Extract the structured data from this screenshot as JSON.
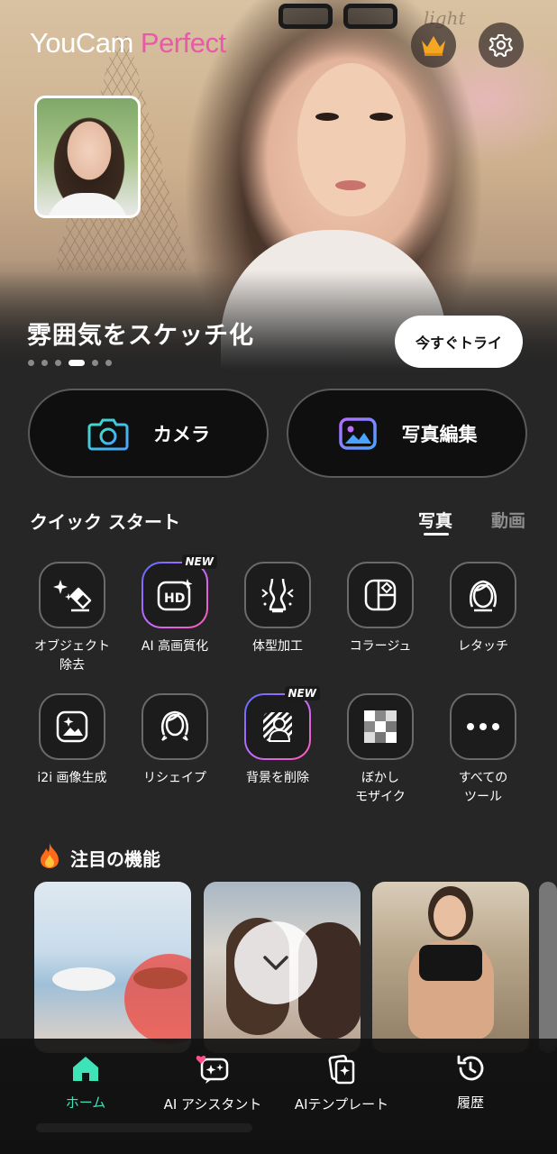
{
  "app": {
    "logo_part1": "YouCam ",
    "logo_part2": "Perfect",
    "brand_color": "#e85aa8"
  },
  "hero": {
    "overlay_script": "light",
    "headline": "雰囲気をスケッチ化",
    "try_button": "今すぐトライ",
    "pager": {
      "count": 6,
      "active_index": 3
    }
  },
  "top_icons": {
    "premium": "crown-icon",
    "settings": "gear-icon"
  },
  "primary_actions": [
    {
      "label": "カメラ",
      "icon": "camera-icon"
    },
    {
      "label": "写真編集",
      "icon": "photo-edit-icon"
    }
  ],
  "quick_start": {
    "title": "クイック スタート",
    "tabs": [
      {
        "label": "写真",
        "active": true
      },
      {
        "label": "動画",
        "active": false
      }
    ],
    "tools": [
      {
        "label": "オブジェクト\n除去",
        "icon": "object-removal-icon",
        "badge": ""
      },
      {
        "label": "AI 高画質化",
        "icon": "hd-enhance-icon",
        "badge": "NEW"
      },
      {
        "label": "体型加工",
        "icon": "body-shape-icon",
        "badge": ""
      },
      {
        "label": "コラージュ",
        "icon": "collage-icon",
        "badge": ""
      },
      {
        "label": "レタッチ",
        "icon": "retouch-icon",
        "badge": ""
      },
      {
        "label": "i2i 画像生成",
        "icon": "image-generation-icon",
        "badge": ""
      },
      {
        "label": "リシェイプ",
        "icon": "reshape-icon",
        "badge": ""
      },
      {
        "label": "背景を削除",
        "icon": "remove-background-icon",
        "badge": "NEW"
      },
      {
        "label": "ぼかし\nモザイク",
        "icon": "mosaic-icon",
        "badge": ""
      },
      {
        "label": "すべての\nツール",
        "icon": "more-icon",
        "badge": ""
      }
    ]
  },
  "featured": {
    "title": "注目の機能",
    "icon": "fire-icon"
  },
  "bottom_nav": [
    {
      "label": "ホーム",
      "icon": "home-icon",
      "active": true
    },
    {
      "label": "AI アシスタント",
      "icon": "ai-assistant-icon",
      "active": false
    },
    {
      "label": "AIテンプレート",
      "icon": "ai-template-icon",
      "active": false
    },
    {
      "label": "履歴",
      "icon": "history-icon",
      "active": false
    }
  ],
  "accent_color": "#3fe3b8"
}
